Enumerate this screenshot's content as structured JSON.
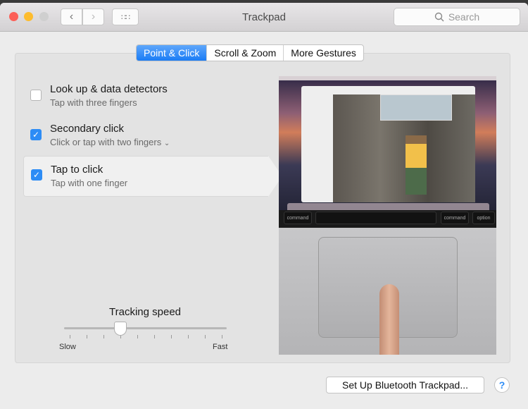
{
  "window": {
    "title": "Trackpad",
    "search_placeholder": "Search"
  },
  "tabs": [
    {
      "label": "Point & Click",
      "active": true
    },
    {
      "label": "Scroll & Zoom"
    },
    {
      "label": "More Gestures"
    }
  ],
  "options": [
    {
      "label": "Look up & data detectors",
      "sub": "Tap with three fingers",
      "checked": false
    },
    {
      "label": "Secondary click",
      "sub": "Click or tap with two fingers",
      "checked": true,
      "has_dropdown": true
    },
    {
      "label": "Tap to click",
      "sub": "Tap with one finger",
      "checked": true,
      "selected": true
    }
  ],
  "tracking": {
    "label": "Tracking speed",
    "min_label": "Slow",
    "max_label": "Fast",
    "value_fraction": 0.333,
    "ticks": 10
  },
  "preview": {
    "keys": [
      "command",
      "command",
      "option"
    ]
  },
  "footer": {
    "setup_label": "Set Up Bluetooth Trackpad...",
    "help_label": "?"
  },
  "colors": {
    "accent": "#2d8cf5",
    "close": "#fc5f57",
    "minimize": "#fdbc2e",
    "zoom_disabled": "#cfcfcf"
  }
}
